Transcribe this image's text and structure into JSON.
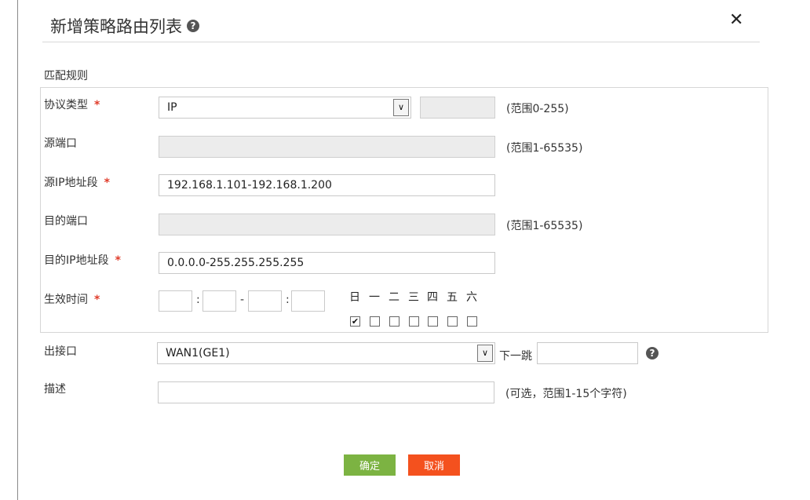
{
  "dialog": {
    "title": "新增策略路由列表",
    "close_symbol": "✕",
    "help_symbol": "?"
  },
  "match_rules": {
    "group_label": "匹配规则",
    "protocol": {
      "label": "协议类型",
      "value": "IP",
      "hint": "(范围0-255)"
    },
    "src_port": {
      "label": "源端口",
      "value": "",
      "hint": "(范围1-65535)"
    },
    "src_ip": {
      "label": "源IP地址段",
      "value": "192.168.1.101-192.168.1.200"
    },
    "dst_port": {
      "label": "目的端口",
      "value": "",
      "hint": "(范围1-65535)"
    },
    "dst_ip": {
      "label": "目的IP地址段",
      "value": "0.0.0.0-255.255.255.255"
    },
    "effective_time": {
      "label": "生效时间",
      "separators": [
        ":",
        "-",
        ":"
      ],
      "days": [
        {
          "label": "日",
          "checked": true
        },
        {
          "label": "一",
          "checked": false
        },
        {
          "label": "二",
          "checked": false
        },
        {
          "label": "三",
          "checked": false
        },
        {
          "label": "四",
          "checked": false
        },
        {
          "label": "五",
          "checked": false
        },
        {
          "label": "六",
          "checked": false
        }
      ]
    }
  },
  "required_mark": "*",
  "outbound": {
    "label": "出接口",
    "value": "WAN1(GE1)",
    "next_hop_label": "下一跳",
    "next_hop_value": ""
  },
  "description": {
    "label": "描述",
    "value": "",
    "hint": "(可选，范围1-15个字符)"
  },
  "buttons": {
    "confirm": "确定",
    "cancel": "取消"
  },
  "colors": {
    "confirm": "#7cb342",
    "cancel": "#f4511e",
    "required": "#e03c2a"
  }
}
